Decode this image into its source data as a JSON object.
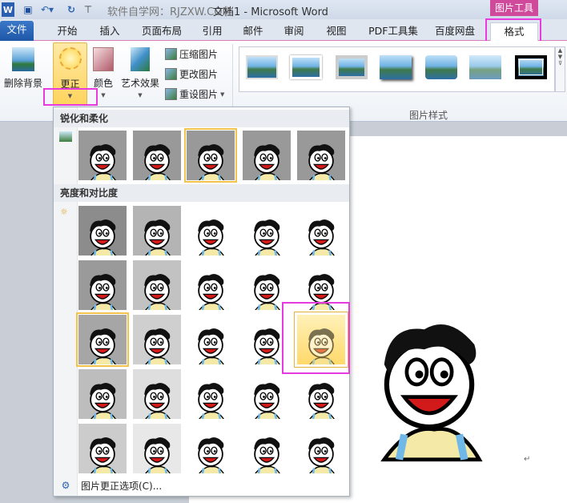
{
  "titlebar": {
    "site": "软件自学网：RJZXW.COM",
    "title": "文档1 - Microsoft Word",
    "tool_context": "图片工具"
  },
  "tabs": [
    "文件",
    "开始",
    "插入",
    "页面布局",
    "引用",
    "邮件",
    "审阅",
    "视图",
    "PDF工具集",
    "百度网盘",
    "格式"
  ],
  "ribbon": {
    "remove_bg": "删除背景",
    "corrections": "更正",
    "color": "颜色",
    "artistic": "艺术效果",
    "compress": "压缩图片",
    "change": "更改图片",
    "reset": "重设图片",
    "styles_group": "图片样式"
  },
  "menu": {
    "sharpen_title": "锐化和柔化",
    "brightness_title": "亮度和对比度",
    "footer": "图片更正选项(C)...",
    "sharpen_tiles": [
      "#999999",
      "#999999",
      "#999999",
      "#999999",
      "#999999"
    ],
    "brightness_tiles": [
      [
        "#8c8c8c",
        "#b4b4b4",
        "#ffffff",
        "#ffffff",
        "#ffffff"
      ],
      [
        "#9a9a9a",
        "#c2c2c2",
        "#ffffff",
        "#ffffff",
        "#ffffff"
      ],
      [
        "#a6a6a6",
        "#cfcfcf",
        "#ffffff",
        "#ffffff",
        "#ffffff"
      ],
      [
        "#bdbdbd",
        "#dedede",
        "#ffffff",
        "#ffffff",
        "#ffffff"
      ],
      [
        "#cccccc",
        "#e8e8e8",
        "#ffffff",
        "#ffffff",
        "#ffffff"
      ]
    ]
  },
  "colors": {
    "accent": "#d04a9c",
    "highlight": "#e73be0",
    "file_tab": "#2b64b5"
  }
}
